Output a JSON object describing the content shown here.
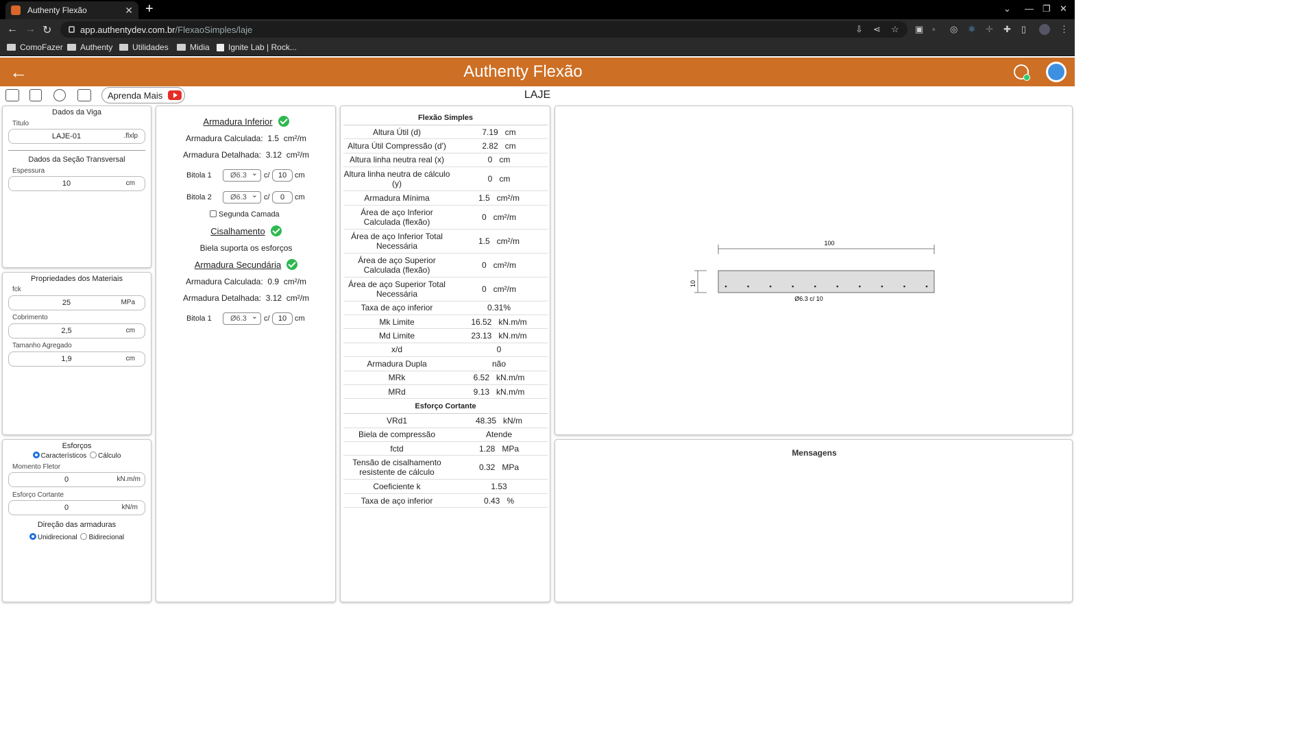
{
  "browser": {
    "tab_title": "Authenty Flexão",
    "url_host": "app.authentydev.com.br",
    "url_path": "/FlexaoSimples/laje",
    "bookmarks": [
      "ComoFazer",
      "Authenty",
      "Utilidades",
      "Midia",
      "Ignite Lab | Rock..."
    ]
  },
  "header": {
    "title": "Authenty Flexão"
  },
  "toolbar": {
    "learn_label": "Aprenda Mais",
    "page_title": "LAJE"
  },
  "viga": {
    "title": "Dados da Viga",
    "titulo_label": "Titulo",
    "titulo_value": "LAJE-01",
    "titulo_ext": ".flxlp",
    "secao_title": "Dados da Seção Transversal",
    "espessura_label": "Espessura",
    "espessura_value": "10",
    "espessura_unit": "cm"
  },
  "materiais": {
    "title": "Propriedades dos Materiais",
    "fck_label": "fck",
    "fck_value": "25",
    "fck_unit": "MPa",
    "cob_label": "Cobrimento",
    "cob_value": "2,5",
    "cob_unit": "cm",
    "agr_label": "Tamanho Agregado",
    "agr_value": "1,9",
    "agr_unit": "cm"
  },
  "esforcos": {
    "title": "Esforços",
    "radio_caract": "Característicos",
    "radio_calc": "Cálculo",
    "momento_label": "Momento Fletor",
    "momento_value": "0",
    "momento_unit": "kN.m/m",
    "cortante_label": "Esforço Cortante",
    "cortante_value": "0",
    "cortante_unit": "kN/m",
    "direcao_title": "Direção das armaduras",
    "radio_uni": "Unidirecional",
    "radio_bi": "Bidirecional"
  },
  "armadura": {
    "inferior_title": "Armadura Inferior",
    "calc_label": "Armadura Calculada:",
    "calc_value": "1.5",
    "calc_unit": "cm²/m",
    "det_label": "Armadura Detalhada:",
    "det_value": "3.12",
    "det_unit": "cm²/m",
    "bitola1_label": "Bitola 1",
    "bitola1_diam": "Ø6.3",
    "bitola1_esp": "10",
    "bitola2_label": "Bitola 2",
    "bitola2_diam": "Ø6.3",
    "bitola2_esp": "0",
    "sep": "c/",
    "unit_cm": "cm",
    "segunda_camada": "Segunda Camada",
    "cis_title": "Cisalhamento",
    "cis_text": "Biela suporta os esforços",
    "sec_title": "Armadura Secundária",
    "sec_calc_label": "Armadura Calculada:",
    "sec_calc_value": "0.9",
    "sec_calc_unit": "cm²/m",
    "sec_det_label": "Armadura Detalhada:",
    "sec_det_value": "3.12",
    "sec_det_unit": "cm²/m",
    "sec_bitola1_label": "Bitola 1",
    "sec_bitola1_diam": "Ø6.3",
    "sec_bitola1_esp": "10"
  },
  "flexao": {
    "title": "Flexão Simples",
    "rows": [
      {
        "name": "Altura Útil (d)",
        "value": "7.19   cm"
      },
      {
        "name": "Altura Útil Compressão (d')",
        "value": "2.82   cm"
      },
      {
        "name": "Altura linha neutra real (x)",
        "value": "0   cm"
      },
      {
        "name": "Altura linha neutra de cálculo (y)",
        "value": "0   cm"
      },
      {
        "name": "Armadura Mínima",
        "value": "1.5   cm²/m"
      },
      {
        "name": "Área de aço Inferior Calculada (flexão)",
        "value": "0   cm²/m"
      },
      {
        "name": "Área de aço Inferior Total Necessária",
        "value": "1.5   cm²/m"
      },
      {
        "name": "Área de aço Superior Calculada (flexão)",
        "value": "0   cm²/m"
      },
      {
        "name": "Área de aço Superior Total Necessária",
        "value": "0   cm²/m"
      },
      {
        "name": "Taxa de aço inferior",
        "value": "0.31%"
      },
      {
        "name": "Mk Limite",
        "value": "16.52   kN.m/m"
      },
      {
        "name": "Md Limite",
        "value": "23.13   kN.m/m"
      },
      {
        "name": "x/d",
        "value": "0"
      },
      {
        "name": "Armadura Dupla",
        "value": "não"
      },
      {
        "name": "MRk",
        "value": "6.52   kN.m/m"
      },
      {
        "name": "MRd",
        "value": "9.13   kN.m/m"
      }
    ]
  },
  "cortante": {
    "title": "Esforço Cortante",
    "rows": [
      {
        "name": "VRd1",
        "value": "48.35   kN/m"
      },
      {
        "name": "Biela de compressão",
        "value": "Atende"
      },
      {
        "name": "fctd",
        "value": "1.28   MPa"
      },
      {
        "name": "Tensão de cisalhamento resistente de cálculo",
        "value": "0.32   MPa"
      },
      {
        "name": "Coeficiente k",
        "value": "1.53"
      },
      {
        "name": "Taxa de aço inferior",
        "value": "0.43   %"
      }
    ]
  },
  "drawing": {
    "width_label": "100",
    "height_label": "10",
    "bar_label": "Ø6.3 c/ 10",
    "bar_count": 10
  },
  "mensagens": {
    "title": "Mensagens"
  }
}
